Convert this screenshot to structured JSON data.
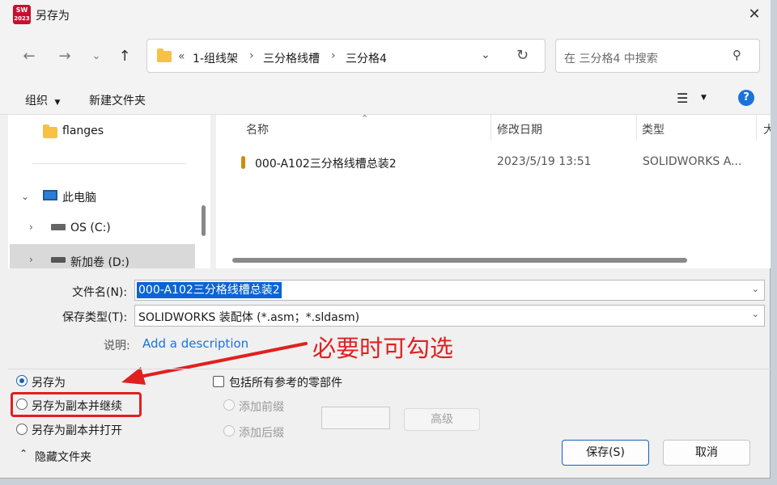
{
  "window": {
    "title": "另存为",
    "logo_text": "SW",
    "logo_year": "2023"
  },
  "address": {
    "prefix": "«",
    "crumbs": [
      "1-组线架",
      "三分格线槽",
      "三分格4"
    ]
  },
  "search": {
    "placeholder": "在 三分格4 中搜索"
  },
  "toolbar": {
    "organize": "组织",
    "new_folder": "新建文件夹"
  },
  "nav": {
    "items": [
      "flanges",
      "此电脑",
      "OS (C:)",
      "新加卷 (D:)"
    ]
  },
  "file_list": {
    "columns": [
      "名称",
      "修改日期",
      "类型",
      "大"
    ],
    "rows": [
      {
        "name": "000-A102三分格线槽总装2",
        "date": "2023/5/19 13:51",
        "type": "SOLIDWORKS A..."
      }
    ]
  },
  "form": {
    "filename_label": "文件名(N):",
    "filename_value": "000-A102三分格线槽总装2",
    "filetype_label": "保存类型(T):",
    "filetype_value": "SOLIDWORKS 装配体 (*.asm；*.sldasm)",
    "desc_label": "说明:",
    "desc_link": "Add a description"
  },
  "options": {
    "save_as": "另存为",
    "save_copy_continue": "另存为副本并继续",
    "save_copy_open": "另存为副本并打开",
    "include_refs": "包括所有参考的零部件",
    "add_prefix": "添加前缀",
    "add_suffix": "添加后缀",
    "advanced": "高级"
  },
  "footer": {
    "hide_folders": "隐藏文件夹",
    "save": "保存(S)",
    "cancel": "取消"
  },
  "annotation": {
    "text": "必要时可勾选"
  },
  "colors": {
    "annotation_red": "#e02020",
    "accent_blue": "#1a73d9",
    "selection_blue": "#0a64d6"
  }
}
